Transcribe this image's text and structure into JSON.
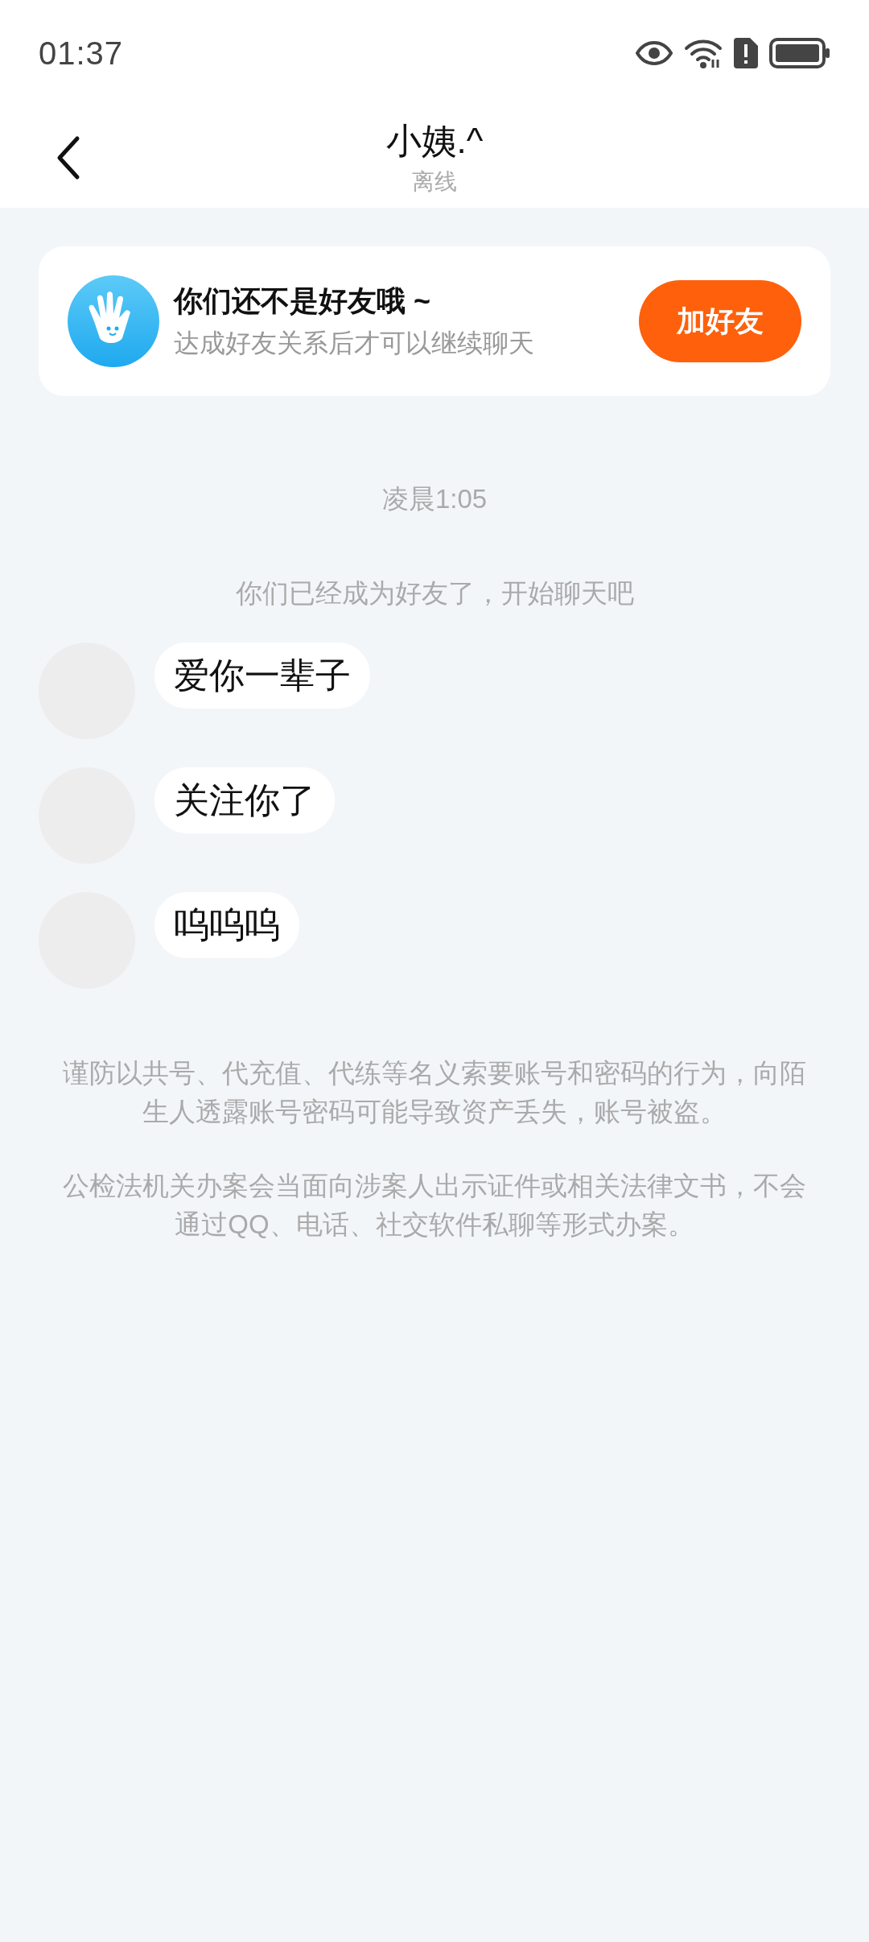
{
  "status_bar": {
    "time": "01:37"
  },
  "header": {
    "title": "小姨.^",
    "subtitle": "离线"
  },
  "friend_notice": {
    "title": "你们还不是好友哦 ~",
    "subtitle": "达成好友关系后才可以继续聊天",
    "button": "加好友"
  },
  "timestamp": "凌晨1:05",
  "system_message": "你们已经成为好友了，开始聊天吧",
  "messages": [
    {
      "text": "爱你一辈子"
    },
    {
      "text": "关注你了"
    },
    {
      "text": "呜呜呜"
    }
  ],
  "warnings": [
    "谨防以共号、代充值、代练等名义索要账号和密码的行为，向陌生人透露账号密码可能导致资产丢失，账号被盗。",
    "公检法机关办案会当面向涉案人出示证件或相关法律文书，不会通过QQ、电话、社交软件私聊等形式办案。"
  ]
}
